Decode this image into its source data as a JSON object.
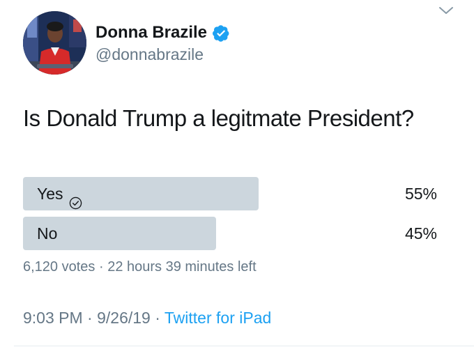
{
  "author": {
    "display_name": "Donna Brazile",
    "handle": "@donnabrazile",
    "verified": true,
    "avatar_icon": "profile-photo"
  },
  "tweet": {
    "text": "Is Donald Trump a legitmate President?"
  },
  "poll": {
    "options": [
      {
        "label": "Yes",
        "percent_label": "55%",
        "fraction": 0.55,
        "selected": true
      },
      {
        "label": "No",
        "percent_label": "45%",
        "fraction": 0.45,
        "selected": false
      }
    ],
    "votes": "6,120 votes",
    "separator": " · ",
    "time_left": "22 hours 39 minutes left"
  },
  "meta": {
    "time": "9:03 PM",
    "separator1": " · ",
    "date": "9/26/19",
    "separator2": " · ",
    "source": "Twitter for iPad"
  },
  "colors": {
    "link": "#1da1f2",
    "secondary_text": "#657786",
    "poll_bar": "#ccd6dd",
    "verified_badge": "#1da1f2"
  },
  "icons": {
    "more": "chevron-down-icon",
    "verified": "verified-badge-icon",
    "vote": "check-circle-icon"
  }
}
